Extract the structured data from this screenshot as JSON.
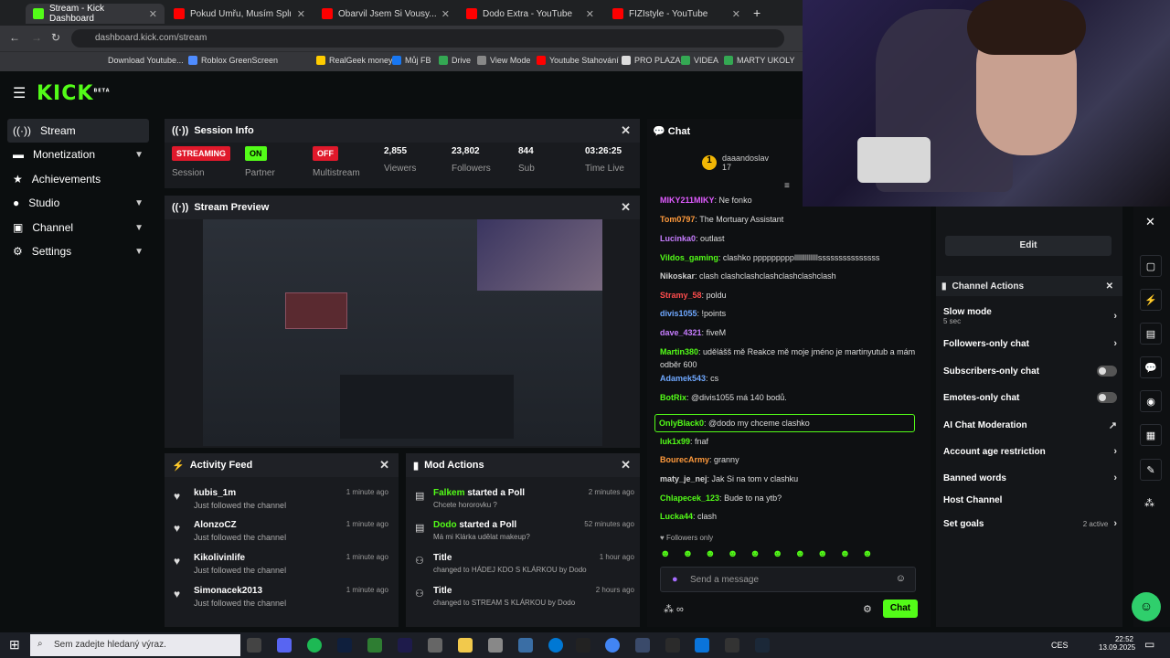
{
  "browser": {
    "tabs": [
      {
        "label": "Stream - Kick Dashboard",
        "icon_color": "#53fc18"
      },
      {
        "label": "Pokud Umřu, Musím Splnit Šíle",
        "icon_color": "#ff0000"
      },
      {
        "label": "Obarvil Jsem Si Vousy... - YouTu",
        "icon_color": "#ff0000"
      },
      {
        "label": "Dodo Extra - YouTube",
        "icon_color": "#ff0000"
      },
      {
        "label": "FIZIstyle - YouTube",
        "icon_color": "#ff0000"
      }
    ],
    "url": "dashboard.kick.com/stream",
    "bookmarks": [
      "Download Youtube...",
      "Roblox GreenScreen",
      "RealGeek money",
      "Můj FB",
      "Drive",
      "View Mode",
      "Youtube Stahování",
      "PRO PLAZA",
      "VIDEA",
      "MARTY UKOLY"
    ]
  },
  "brand": {
    "logo": "KICK",
    "beta": "BETA",
    "accent": "#53fc18"
  },
  "sidebar": {
    "items": [
      {
        "label": "Stream",
        "icon": "stream-icon",
        "chevron": false
      },
      {
        "label": "Monetization",
        "icon": "monetization-icon",
        "chevron": true
      },
      {
        "label": "Achievements",
        "icon": "achievements-icon",
        "chevron": false
      },
      {
        "label": "Studio",
        "icon": "studio-icon",
        "chevron": true
      },
      {
        "label": "Channel",
        "icon": "channel-icon",
        "chevron": true
      },
      {
        "label": "Settings",
        "icon": "settings-icon",
        "chevron": true
      }
    ]
  },
  "session": {
    "title": "Session Info",
    "status": "STREAMING",
    "status_label": "Session",
    "partner": "ON",
    "partner_label": "Partner",
    "multistream": "OFF",
    "multistream_label": "Multistream",
    "viewers": "2,855",
    "viewers_label": "Viewers",
    "followers": "23,802",
    "followers_label": "Followers",
    "subs": "844",
    "subs_label": "Sub",
    "time": "03:26:25",
    "time_label": "Time Live"
  },
  "preview": {
    "title": "Stream Preview"
  },
  "activity": {
    "title": "Activity Feed",
    "items": [
      {
        "name": "kubis_1m",
        "text": "Just followed the channel",
        "time": "1 minute ago"
      },
      {
        "name": "AlonzoCZ",
        "text": "Just followed the channel",
        "time": "1 minute ago"
      },
      {
        "name": "Kikolivinlife",
        "text": "Just followed the channel",
        "time": "1 minute ago"
      },
      {
        "name": "Simonacek2013",
        "text": "Just followed the channel",
        "time": "1 minute ago"
      }
    ]
  },
  "mod": {
    "title": "Mod Actions",
    "items": [
      {
        "name": "Falkem",
        "action": "started a Poll",
        "detail": "Chcete hororovku ?",
        "time": "2 minutes ago"
      },
      {
        "name": "Dodo",
        "action": "started a Poll",
        "detail": "Má mi Klárka udělat makeup?",
        "time": "52 minutes ago"
      },
      {
        "name": "Title",
        "action": "",
        "detail": "changed to HÁDEJ KDO S KLÁRKOU by Dodo",
        "time": "1 hour ago"
      },
      {
        "name": "Title",
        "action": "",
        "detail": "changed to STREAM S KLÁRKOU by Dodo",
        "time": "2 hours ago"
      }
    ]
  },
  "chat": {
    "title": "Chat",
    "top_user": "daaandoslav",
    "top_count": "17",
    "messages": [
      {
        "user": "MIKY211MIKY",
        "color": "#e05cff",
        "text": "Ne fonko"
      },
      {
        "user": "Tom0797",
        "color": "#ff9a3c",
        "text": "The Mortuary Assistant"
      },
      {
        "user": "Lucinka0",
        "color": "#c77dff",
        "text": "outlast"
      },
      {
        "user": "Vildos_gaming",
        "color": "#53fc18",
        "text": "clashko ppppppppplllllllllllllsssssssssssssss"
      },
      {
        "user": "Nikoskar",
        "color": "#cfcfcf",
        "text": "clash clashclashclashclashclashclash"
      },
      {
        "user": "Stramy_58",
        "color": "#ff4d4d",
        "text": "poldu"
      },
      {
        "user": "divis1055",
        "color": "#6fa8ff",
        "text": "!points"
      },
      {
        "user": "dave_4321",
        "color": "#c77dff",
        "text": "fiveM"
      },
      {
        "user": "Martin380",
        "color": "#53fc18",
        "text": "udělášš mě Reakce mě moje jméno je martinyutub a mám odběr 600"
      },
      {
        "user": "Adamek543",
        "color": "#6fa8ff",
        "text": "cs"
      },
      {
        "user": "BotRix",
        "color": "#53fc18",
        "text": "@divis1055 má 140 bodů."
      },
      {
        "user": "OnlyBlack0",
        "color": "#53fc18",
        "text": "@dodo my chceme clashko"
      },
      {
        "user": "luk1x99",
        "color": "#53fc18",
        "text": "fnaf"
      },
      {
        "user": "BourecArmy",
        "color": "#ff9a3c",
        "text": "granny"
      },
      {
        "user": "maty_je_nej",
        "color": "#cfcfcf",
        "text": "Jak Si na tom v clashku"
      },
      {
        "user": "Chlapecek_123",
        "color": "#53fc18",
        "text": "Bude to na ytb?"
      },
      {
        "user": "Lucka44",
        "color": "#53fc18",
        "text": "clash"
      }
    ],
    "followers_only": "Followers only",
    "placeholder": "Send a message",
    "send": "Chat"
  },
  "actions": {
    "edit": "Edit",
    "title": "Channel Actions",
    "items": [
      {
        "label": "Slow mode",
        "sub": "5 sec",
        "type": "arrow"
      },
      {
        "label": "Followers-only chat",
        "sub": "",
        "type": "arrow"
      },
      {
        "label": "Subscribers-only chat",
        "sub": "",
        "type": "toggle"
      },
      {
        "label": "Emotes-only chat",
        "sub": "",
        "type": "toggle"
      },
      {
        "label": "AI Chat Moderation",
        "sub": "",
        "type": "external"
      },
      {
        "label": "Account age restriction",
        "sub": "",
        "type": "arrow"
      },
      {
        "label": "Banned words",
        "sub": "",
        "type": "arrow"
      },
      {
        "label": "Host Channel",
        "sub": "",
        "type": "none"
      },
      {
        "label": "Set goals",
        "sub": "",
        "type": "arrow",
        "extra": "2 active"
      }
    ]
  },
  "taskbar": {
    "search": "Sem zadejte hledaný výraz.",
    "lang": "CES",
    "time": "22:52",
    "date": "13.09.2025"
  }
}
